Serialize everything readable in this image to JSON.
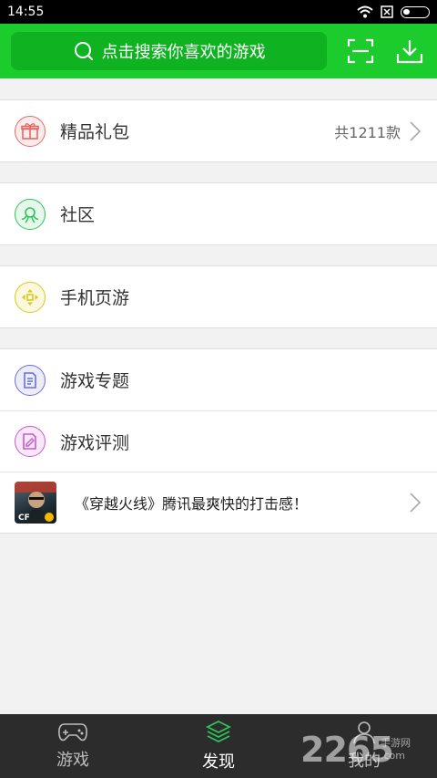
{
  "status_bar": {
    "time": "14:55"
  },
  "header": {
    "search_placeholder": "点击搜索你喜欢的游戏"
  },
  "menu": {
    "gift": {
      "label": "精品礼包",
      "count": "共1211款"
    },
    "community": {
      "label": "社区"
    },
    "mobile_web_games": {
      "label": "手机页游"
    },
    "topics": {
      "label": "游戏专题"
    },
    "reviews": {
      "label": "游戏评测"
    },
    "promo": {
      "text": "《穿越火线》腾讯最爽快的打击感！"
    }
  },
  "bottom_nav": {
    "games": "游戏",
    "discover": "发现",
    "mine": "我的"
  },
  "watermark": {
    "brand": "2265",
    "cn": "手游网",
    "domain": ".com"
  },
  "colors": {
    "accent": "#1ccb2c",
    "gift": "#e06a6a",
    "community": "#2fc25b",
    "mobile": "#d9c91f",
    "topics": "#6b6fd6",
    "reviews": "#c75ad1"
  },
  "icons": [
    "search-icon",
    "scan-icon",
    "download-icon",
    "gift-icon",
    "community-icon",
    "gamepad-cross-icon",
    "topic-icon",
    "review-icon",
    "chevron-right-icon",
    "controller-icon",
    "cube-icon",
    "user-icon"
  ]
}
